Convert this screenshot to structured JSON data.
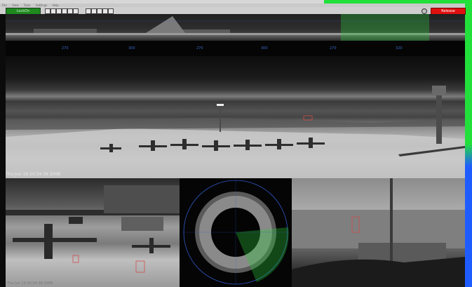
{
  "toolbar": {
    "lock_on_label": "LockOn",
    "release_label": "Release",
    "menu": [
      "File",
      "View",
      "Tools",
      "Settings",
      "Help"
    ]
  },
  "panorama": {
    "tick_labels": [
      "270",
      "300",
      "270",
      "300",
      "270",
      "320"
    ]
  },
  "main_view": {
    "timestamp": "Thu Jun 19 20:34:36 2008"
  },
  "bottom_left": {
    "timestamp": "Thu Jun 19 20:34:36 2008"
  },
  "colors": {
    "accent_green": "#22e03a",
    "lock_green": "#1e8a1e",
    "release_red": "#e01010",
    "blue_rail": "#1f5cff",
    "overlay_blue": "#2f59c7"
  },
  "icons": [
    "cursor-icon",
    "zoom-icon",
    "pan-icon",
    "record-icon",
    "camera-icon",
    "info-icon",
    "target-icon",
    "flag-icon",
    "alert-icon",
    "grid-icon",
    "settings-icon"
  ]
}
